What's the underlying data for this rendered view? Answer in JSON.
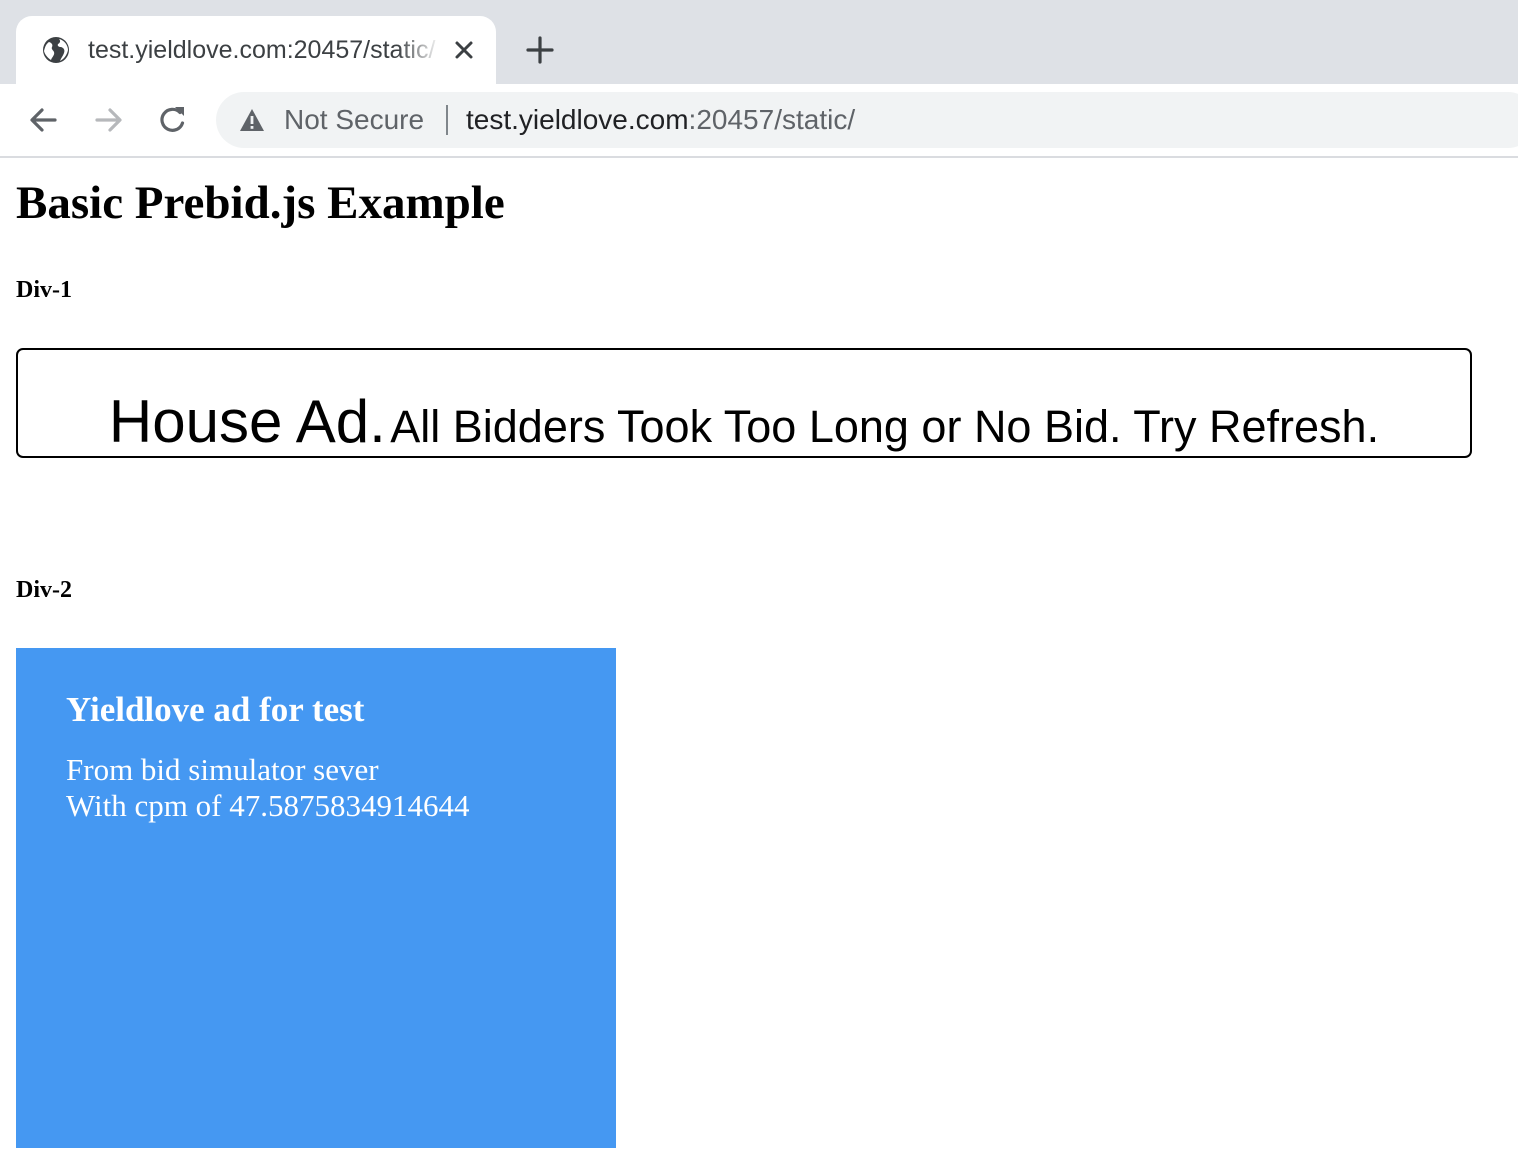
{
  "browser": {
    "tab": {
      "title": "test.yieldlove.com:20457/static/",
      "favicon_icon": "globe-icon",
      "close_icon": "close-icon"
    },
    "new_tab_icon": "plus-icon",
    "nav": {
      "back_icon": "arrow-left-icon",
      "forward_icon": "arrow-right-icon",
      "reload_icon": "reload-icon"
    },
    "omnibox": {
      "security_icon": "warning-icon",
      "security_label": "Not Secure",
      "url_host": "test.yieldlove.com",
      "url_rest": ":20457/static/"
    }
  },
  "page": {
    "title": "Basic Prebid.js Example",
    "div1": {
      "heading": "Div-1",
      "house_ad_strong": "House Ad.",
      "house_ad_text": "All Bidders Took Too Long or No Bid. Try Refresh."
    },
    "div2": {
      "heading": "Div-2",
      "ad_title": "Yieldlove ad for test",
      "ad_line1": "From bid simulator sever",
      "ad_line2": "With cpm of 47.5875834914644",
      "ad_background": "#4598f2"
    }
  }
}
